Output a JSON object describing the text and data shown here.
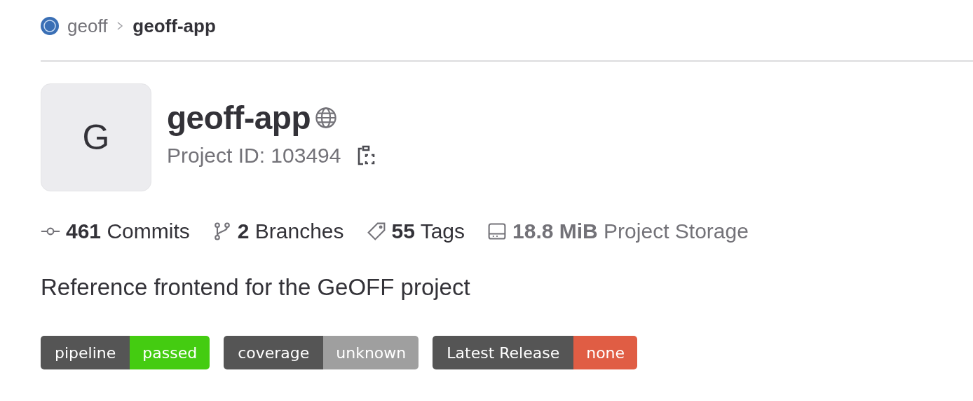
{
  "breadcrumb": [
    {
      "label": "geoff",
      "current": false
    },
    {
      "label": "geoff-app",
      "current": true
    }
  ],
  "project": {
    "avatar_letter": "G",
    "title": "geoff-app",
    "id_label": "Project ID: 103494"
  },
  "stats": [
    {
      "kind": "commits",
      "value": "461",
      "label": "Commits"
    },
    {
      "kind": "branches",
      "value": "2",
      "label": "Branches"
    },
    {
      "kind": "tags",
      "value": "55",
      "label": "Tags"
    },
    {
      "kind": "storage",
      "value": "18.8 MiB",
      "label": "Project Storage"
    }
  ],
  "description": "Reference frontend for the GeOFF project",
  "badges": [
    {
      "label": "pipeline",
      "value": "passed",
      "color": "#4c1"
    },
    {
      "label": "coverage",
      "value": "unknown",
      "color": "#9f9f9f"
    },
    {
      "label": "Latest Release",
      "value": "none",
      "color": "#e05d44"
    }
  ]
}
